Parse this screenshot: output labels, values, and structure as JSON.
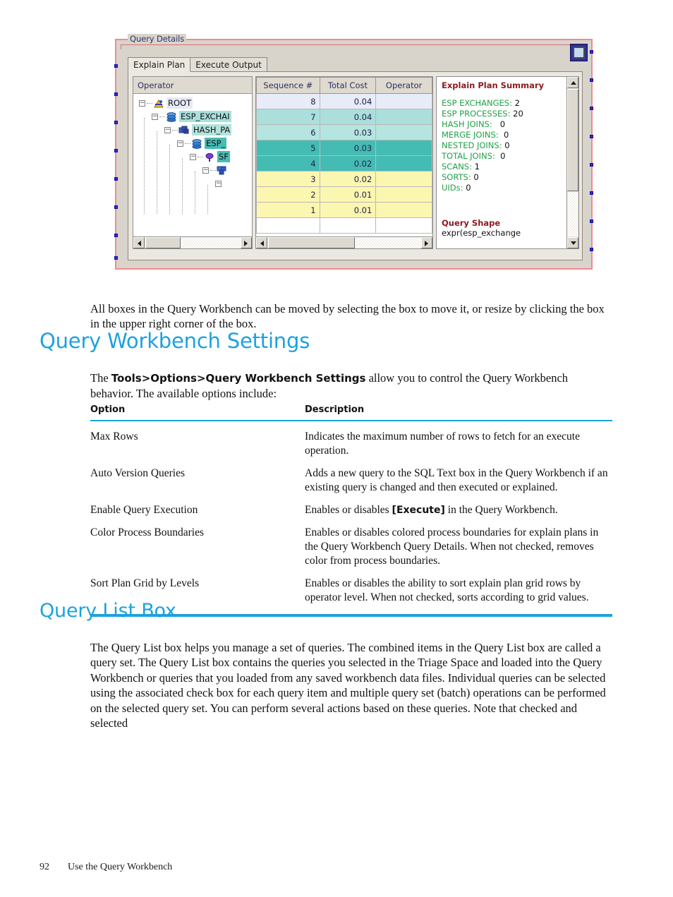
{
  "figure": {
    "group_label": "Query Details",
    "resize_handle": "resize-handle",
    "tabs": [
      {
        "label": "Explain Plan",
        "active": true
      },
      {
        "label": "Execute Output",
        "active": false
      }
    ],
    "tree_panel": {
      "header": "Operator",
      "nodes": [
        {
          "label": "ROOT",
          "icon": "root-icon",
          "highlight": "lavender"
        },
        {
          "label": "ESP_EXCHAI",
          "icon": "esp-exchange-icon",
          "highlight": "teal-light"
        },
        {
          "label": "HASH_PA",
          "icon": "hash-partition-icon",
          "highlight": "teal-light2"
        },
        {
          "label": "ESP_",
          "icon": "esp-exchange-icon",
          "highlight": "teal-dark"
        },
        {
          "label": "SF",
          "icon": "sort-icon",
          "highlight": "teal-dark"
        },
        {
          "label": "",
          "icon": "scan-icon",
          "highlight": "none"
        },
        {
          "label": "",
          "icon": "none",
          "highlight": "none"
        }
      ]
    },
    "grid_panel": {
      "columns": [
        "Sequence #",
        "Total Cost",
        "Operator"
      ],
      "rows": [
        {
          "sequence": "8",
          "total_cost": "0.04",
          "operator": "",
          "color": "lavender"
        },
        {
          "sequence": "7",
          "total_cost": "0.04",
          "operator": "",
          "color": "teal-light"
        },
        {
          "sequence": "6",
          "total_cost": "0.03",
          "operator": "",
          "color": "teal-light2"
        },
        {
          "sequence": "5",
          "total_cost": "0.03",
          "operator": "",
          "color": "teal-dark"
        },
        {
          "sequence": "4",
          "total_cost": "0.02",
          "operator": "",
          "color": "teal-dark"
        },
        {
          "sequence": "3",
          "total_cost": "0.02",
          "operator": "",
          "color": "yellow"
        },
        {
          "sequence": "2",
          "total_cost": "0.01",
          "operator": "",
          "color": "yellow"
        },
        {
          "sequence": "1",
          "total_cost": "0.01",
          "operator": "",
          "color": "yellow"
        }
      ]
    },
    "summary_panel": {
      "title": "Explain Plan Summary",
      "metrics": [
        {
          "label": "ESP EXCHANGES:",
          "value": "2"
        },
        {
          "label": "ESP PROCESSES:",
          "value": "20"
        },
        {
          "label": "HASH JOINS:",
          "value": "0"
        },
        {
          "label": "MERGE JOINS:",
          "value": "0"
        },
        {
          "label": "NESTED JOINS:",
          "value": "0"
        },
        {
          "label": "TOTAL JOINS:",
          "value": "0"
        },
        {
          "label": "SCANS:",
          "value": "1"
        },
        {
          "label": "SORTS:",
          "value": "0"
        },
        {
          "label": "UIDs:",
          "value": "0"
        }
      ],
      "shape_title": "Query Shape",
      "shape_text": "expr(esp_exchange"
    },
    "colors": {
      "selection_border": "#f2898f",
      "teal_dark": "#45bcb3",
      "teal_light": "#aadfdb",
      "yellow": "#fcf7b0",
      "lavender": "#e8ebf8",
      "summary_title": "#8d1b20",
      "summary_metric": "#22a047"
    }
  },
  "body": {
    "intro_paragraph": "All boxes in the Query Workbench can be moved by selecting the box to move it, or resize by clicking the box in the upper right corner of the box.",
    "heading_settings": "Query Workbench Settings",
    "settings_intro_pre": "The ",
    "settings_intro_bold": "Tools>Options>Query Workbench Settings",
    "settings_intro_post": " allow you to control the Query Workbench behavior. The available options include:",
    "heading_query_list": "Query List Box",
    "query_list_paragraph": "The Query List box helps you manage a set of queries. The combined items in the Query List box are called a query set. The Query List box contains the queries you selected in the Triage Space and loaded into the Query Workbench or queries that you loaded from any saved workbench data files. Individual queries can be selected using the associated check box for each query item and multiple query set (batch) operations can be performed on the selected query set. You can perform several actions based on these queries. Note that checked and selected"
  },
  "options_table": {
    "headers": [
      "Option",
      "Description"
    ],
    "rows": [
      {
        "option": "Max Rows",
        "description": "Indicates the maximum number of rows to fetch for an execute operation."
      },
      {
        "option": "Auto Version Queries",
        "description": "Adds a new query to the SQL Text box in the Query Workbench if an existing query is changed and then executed or explained."
      },
      {
        "option": "Enable Query Execution",
        "description_pre": "Enables or disables ",
        "description_bold": "[Execute]",
        "description_post": " in the Query Workbench."
      },
      {
        "option": "Color Process Boundaries",
        "description": "Enables or disables colored process boundaries for explain plans in the Query Workbench Query Details. When not checked, removes color from process boundaries."
      },
      {
        "option": "Sort Plan Grid by Levels",
        "description": "Enables or disables the ability to sort explain plan grid rows by operator level. When not checked, sorts according to grid values."
      }
    ],
    "rule_color": "#1ca2de"
  },
  "footer": {
    "page_number": "92",
    "chapter": "Use the Query Workbench"
  }
}
